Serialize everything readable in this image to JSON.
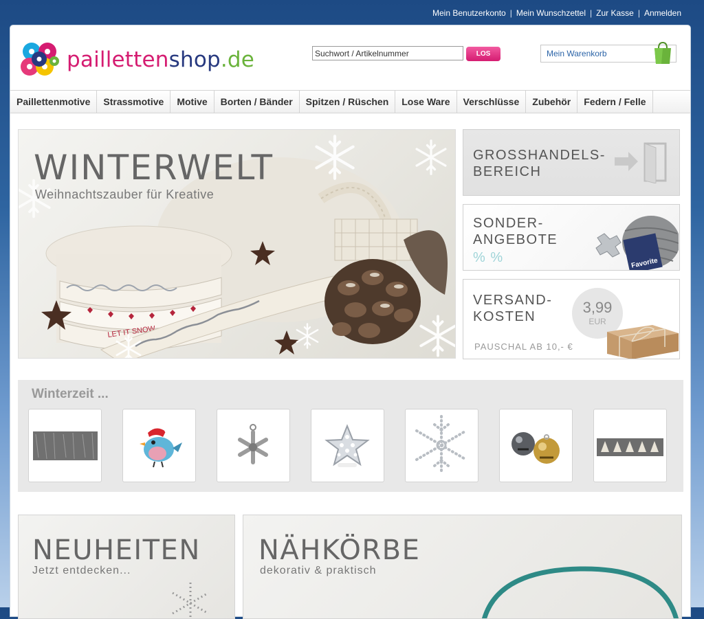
{
  "top_links": [
    "Mein Benutzerkonto",
    "Mein Wunschzettel",
    "Zur Kasse",
    "Anmelden"
  ],
  "logo": {
    "part1": "pailletten",
    "part2": "shop",
    "part3": ".de"
  },
  "search": {
    "placeholder": "Suchwort / Artikelnummer",
    "button_label": "LOS"
  },
  "cart": {
    "label": "Mein Warenkorb"
  },
  "nav": [
    "Paillettenmotive",
    "Strassmotive",
    "Motive",
    "Borten / Bänder",
    "Spitzen / Rüschen",
    "Lose Ware",
    "Verschlüsse",
    "Zubehör",
    "Federn / Felle"
  ],
  "hero": {
    "title": "WINTERWELT",
    "subtitle": "Weihnachtszauber für Kreative",
    "ribbon_text": "LET IT SNOW"
  },
  "side_boxes": {
    "wholesale": {
      "line1": "GROSSHANDELS-",
      "line2": "BEREICH"
    },
    "offers": {
      "line1": "SONDER-",
      "line2": "ANGEBOTE",
      "percent": "%  %",
      "yarn_brand": "Favorite"
    },
    "shipping": {
      "line1": "VERSAND-",
      "line2": "KOSTEN",
      "price": "3,99",
      "currency": "EUR",
      "note": "PAUSCHAL AB 10,- €"
    }
  },
  "winter": {
    "title": "Winterzeit ...",
    "items": [
      "fur-trim",
      "bird-motif",
      "snowflake-charm",
      "rhinestone-star",
      "rhinestone-snowflake",
      "jingle-bells",
      "tree-ribbon"
    ]
  },
  "banners": {
    "news": {
      "title": "NEUHEITEN",
      "subtitle": "Jetzt entdecken..."
    },
    "baskets": {
      "title": "NÄHKÖRBE",
      "subtitle": "dekorativ & praktisch"
    }
  },
  "colors": {
    "brand_pink": "#d51c71",
    "brand_blue": "#27397f",
    "brand_green": "#6ab33b",
    "link_blue": "#2a63a7"
  }
}
